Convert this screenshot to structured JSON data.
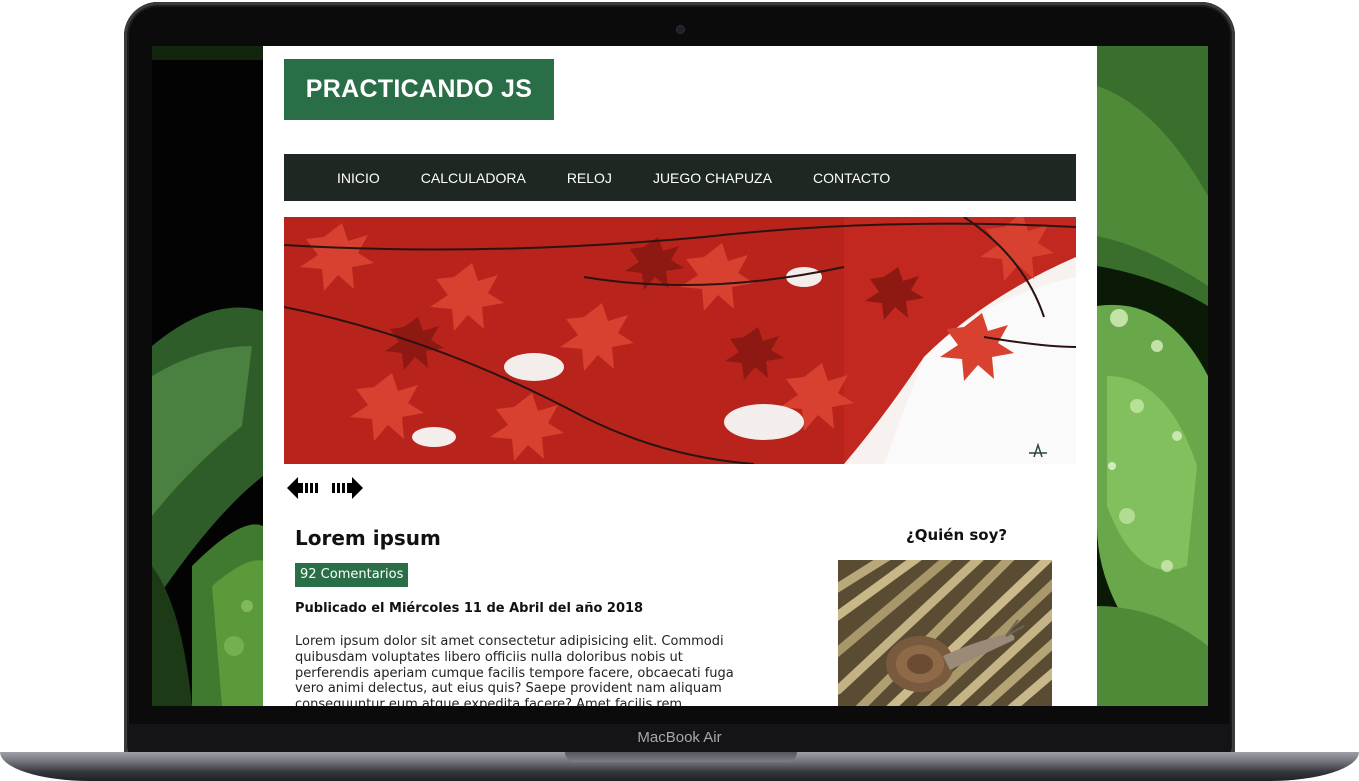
{
  "device": {
    "model_label": "MacBook Air"
  },
  "site": {
    "logo_text": "PRACTICANDO JS",
    "accent_color": "#2a6e48",
    "nav_background": "#1f2723",
    "nav": [
      {
        "label": "INICIO"
      },
      {
        "label": "CALCULADORA"
      },
      {
        "label": "RELOJ"
      },
      {
        "label": "JUEGO CHAPUZA"
      },
      {
        "label": "CONTACTO"
      }
    ],
    "slider": {
      "image": "red-maple-leaves",
      "prev_icon": "arrow-left-icon",
      "next_icon": "arrow-right-icon"
    }
  },
  "article": {
    "title": "Lorem ipsum",
    "comments": "92 Comentarios",
    "date": "Publicado el Miércoles 11 de Abril del año 2018",
    "body": "Lorem ipsum dolor sit amet consectetur adipisicing elit. Commodi quibusdam voluptates libero officiis nulla doloribus nobis ut perferendis aperiam cumque facilis tempore facere, obcaecati fuga vero animi delectus, aut eius quis? Saepe provident nam aliquam consequuntur eum atque expedita facere? Amet facilis rem"
  },
  "aside": {
    "title": "¿Quién soy?",
    "photo": "snail-on-bamboo"
  }
}
